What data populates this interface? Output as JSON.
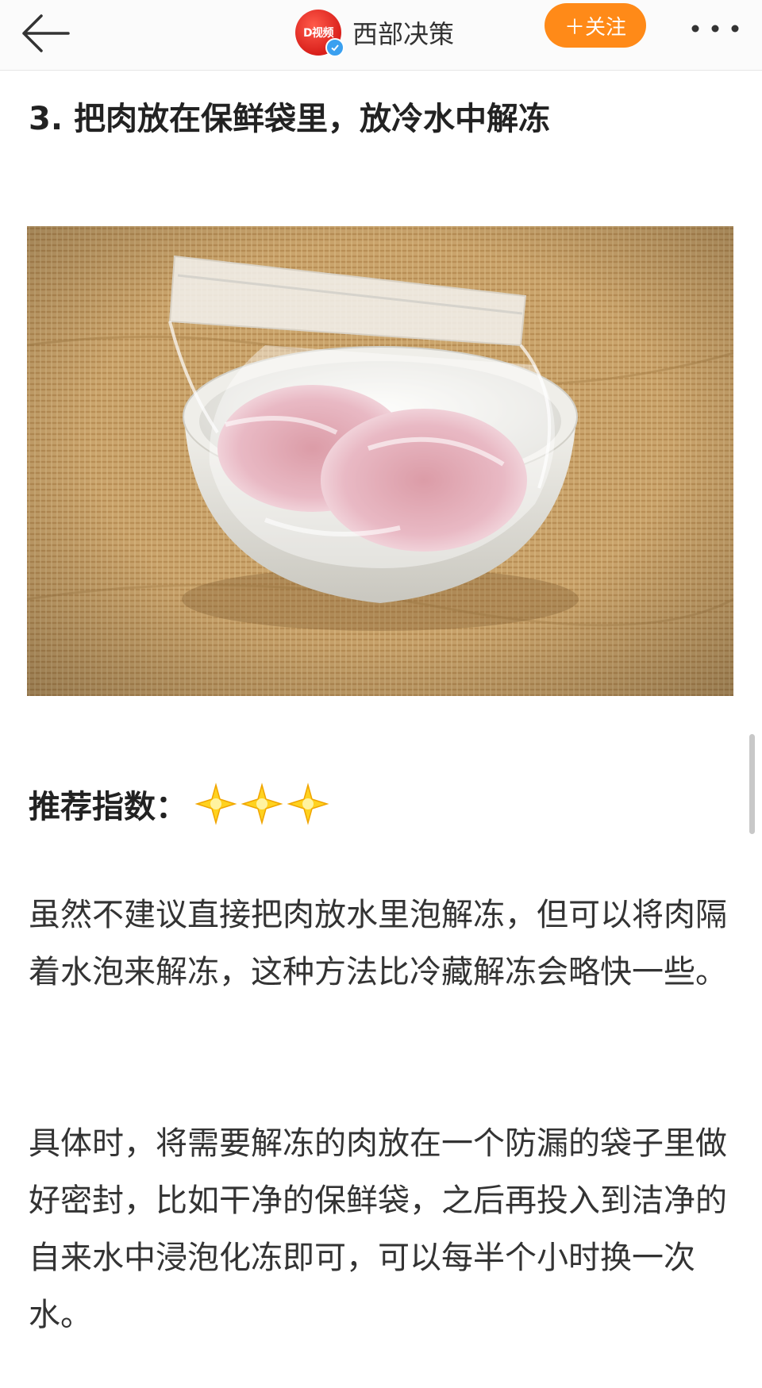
{
  "header": {
    "back_icon": "arrow-left-icon",
    "author_name": "西部决策",
    "avatar_badge": "D视频",
    "verified_icon": "verified-check-icon",
    "follow_label": "＋关注",
    "more_icon": "ellipsis-icon",
    "accent_color": "#ff8a18"
  },
  "article": {
    "step_title": "3. 把肉放在保鲜袋里，放冷水中解冻",
    "photo_icon": "photo-frozen-meat-in-bag",
    "rating_label": "推荐指数：",
    "rating_stars": 3,
    "star_icon": "sparkle-star-icon",
    "paragraphs": [
      "虽然不建议直接把肉放水里泡解冻，但可以将肉隔着水泡来解冻，这种方法比冷藏解冻会略快一些。",
      "具体时，将需要解冻的肉放在一个防漏的袋子里做好密封，比如干净的保鲜袋，之后再投入到洁净的自来水中浸泡化冻即可，可以每半个小时换一次水。"
    ]
  }
}
